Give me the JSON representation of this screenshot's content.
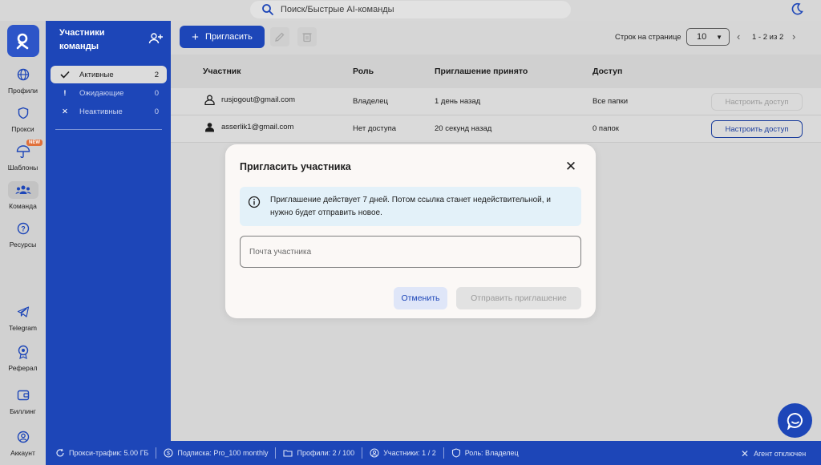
{
  "search": {
    "placeholder": "Поиск/Быстрые AI-команды"
  },
  "rail": {
    "items": [
      {
        "label": "Профили",
        "icon": "globe-icon"
      },
      {
        "label": "Прокси",
        "icon": "shield-icon"
      },
      {
        "label": "Шаблоны",
        "icon": "umbrella-icon",
        "badge": "NEW"
      },
      {
        "label": "Команда",
        "icon": "team-icon"
      },
      {
        "label": "Ресурсы",
        "icon": "help-icon"
      },
      {
        "label": "Telegram",
        "icon": "telegram-icon"
      },
      {
        "label": "Реферал",
        "icon": "referral-icon"
      },
      {
        "label": "Биллинг",
        "icon": "wallet-icon"
      },
      {
        "label": "Аккаунт",
        "icon": "account-icon"
      }
    ]
  },
  "panel": {
    "title": "Участники команды",
    "filters": [
      {
        "label": "Активные",
        "count": "2",
        "icon": "check-icon",
        "active": true
      },
      {
        "label": "Ожидающие",
        "count": "0",
        "icon": "exclamation-icon",
        "active": false
      },
      {
        "label": "Неактивные",
        "count": "0",
        "icon": "cross-icon",
        "active": false
      }
    ]
  },
  "toolbar": {
    "invite_label": "Пригласить",
    "rows_label": "Строк на странице",
    "rows_value": "10",
    "pager_text": "1 - 2 из 2"
  },
  "table": {
    "headers": [
      "Участник",
      "Роль",
      "Приглашение принято",
      "Доступ"
    ],
    "rows": [
      {
        "email": "rusjogout@gmail.com",
        "role": "Владелец",
        "accepted": "1 день назад",
        "access": "Все папки",
        "button": "Настроить доступ",
        "button_enabled": false
      },
      {
        "email": "asserlik1@gmail.com",
        "role": "Нет доступа",
        "accepted": "20 секунд назад",
        "access": "0 папок",
        "button": "Настроить доступ",
        "button_enabled": true
      }
    ]
  },
  "bottombar": {
    "traffic": "Прокси-трафик: 5.00 ГБ",
    "subscription": "Подписка: Pro_100 monthly",
    "profiles": "Профили: 2 / 100",
    "members": "Участники: 1 / 2",
    "role": "Роль: Владелец",
    "agent": "Агент отключен"
  },
  "modal": {
    "title": "Пригласить участника",
    "info": "Приглашение действует 7 дней. Потом ссылка станет недействительной, и нужно будет отправить новое.",
    "email_placeholder": "Почта участника",
    "cancel_label": "Отменить",
    "send_label": "Отправить приглашение"
  },
  "colors": {
    "brand_blue": "#1d46b8",
    "info_bg": "#e3f1f9",
    "new_badge": "#e0703a"
  }
}
